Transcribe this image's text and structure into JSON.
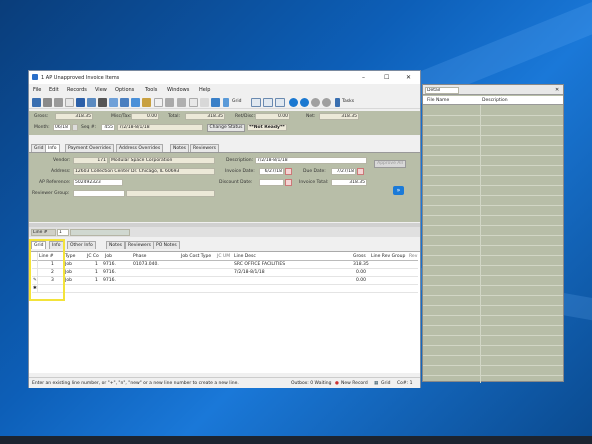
{
  "window": {
    "title": "1 AP Unapproved Invoice Items",
    "min": "–",
    "max": "☐",
    "close": "✕"
  },
  "menu": [
    "File",
    "Edit",
    "Records",
    "View",
    "Options",
    "Tools",
    "Windows",
    "Help"
  ],
  "toolbar": {
    "grid_label": "Grid",
    "tasks_label": "Tasks"
  },
  "summary": {
    "gross_label": "Gross:",
    "gross": "318.35",
    "misc_label": "Misc/Tax:",
    "misc": "0.00",
    "total_label": "Total:",
    "total": "318.35",
    "retdisc_label": "Ret/Disc:",
    "retdisc": "0.00",
    "net_label": "Net:",
    "net": "318.35",
    "month_label": "Month:",
    "month": "06/18",
    "seq_label": "Seq #:",
    "seq": "455",
    "desc": "7/2/18-8/1/18",
    "change_status": "Change Status",
    "status": "**Not Ready**"
  },
  "tabs": [
    "Grid",
    "Info",
    "Payment Overrides",
    "Address Overrides",
    "Notes",
    "Reviewers"
  ],
  "header": {
    "vendor_label": "Vendor:",
    "vendor_num": "171",
    "vendor_name": "Modular Space Corporation",
    "address_label": "Address:",
    "address": "12603 Collection Center Dr.  Chicago, IL  60693",
    "apref_label": "AP Reference:",
    "apref": "502492323",
    "reviewer_label": "Reviewer Group:",
    "description_label": "Description:",
    "description": "7/2/18-8/1/18",
    "invdate_label": "Invoice Date:",
    "invdate": "6/27/18",
    "duedate_label": "Due Date:",
    "duedate": "7/27/18",
    "discdate_label": "Discount Date:",
    "invtotal_label": "Invoice Total:",
    "invtotal": "318.35",
    "approve": "Approve All"
  },
  "lines_tab": "Line #",
  "lines_value": "1",
  "tabs_lower": [
    "Grid",
    "Info",
    "Other Info",
    "Notes",
    "Reviewers",
    "PO Notes"
  ],
  "grid": {
    "headers": [
      "Line #",
      "Type",
      "JC Co",
      "Job",
      "Phase",
      "Job Cost Type",
      "JC UM",
      "Line Desc",
      "Gross",
      "Line Rev Group",
      "Rev"
    ],
    "rows": [
      {
        "line": "1",
        "type": "Job",
        "jcco": "1",
        "job": "9716.",
        "phase": "01073.040.",
        "desc": "SRC OFFICE FACILITIES",
        "gross": "318.35"
      },
      {
        "line": "2",
        "type": "Job",
        "jcco": "1",
        "job": "9716.",
        "phase": "",
        "desc": "7/2/18-8/1/18",
        "gross": "0.00"
      },
      {
        "line": "3",
        "type": "Job",
        "jcco": "1",
        "job": "9716.",
        "phase": "",
        "desc": "",
        "gross": "0.00"
      }
    ]
  },
  "status": {
    "hint": "Enter an existing line number, or \"+\", \"n\", \"new\" or a new line number to create a new line.",
    "outbox": "Outbox: 0 Waiting",
    "newrecord": "New Record",
    "grid": "Grid",
    "co": "Co#: 1"
  },
  "detail": {
    "title": "Detail",
    "col1": "File Name",
    "col2": "Description",
    "close": "✕"
  }
}
